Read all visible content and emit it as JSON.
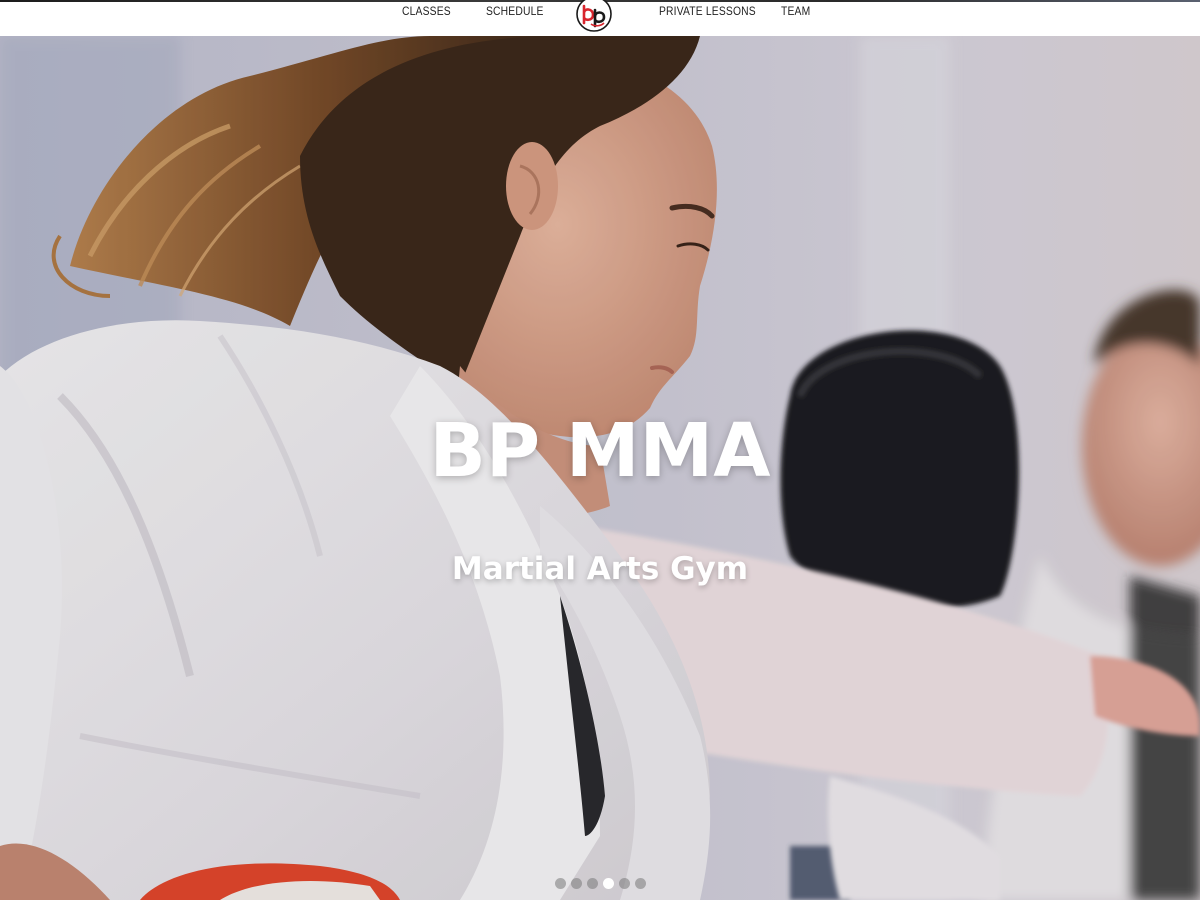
{
  "nav": {
    "items": [
      {
        "label": "CLASSES"
      },
      {
        "label": "SCHEDULE"
      },
      {
        "label": "PRIVATE LESSONS"
      },
      {
        "label": "TEAM"
      }
    ],
    "logo_icon": "bp-logo-icon"
  },
  "hero": {
    "title": "BP MMA",
    "subtitle": "Martial Arts Gym",
    "image_icon": "martial-arts-training-photo"
  },
  "carousel": {
    "slide_count": 6,
    "active_index": 3
  },
  "colors": {
    "logo_red": "#d8252d",
    "logo_dark": "#1a1a1a",
    "hero_text": "#ffffff",
    "belt_red": "#e2472c"
  }
}
